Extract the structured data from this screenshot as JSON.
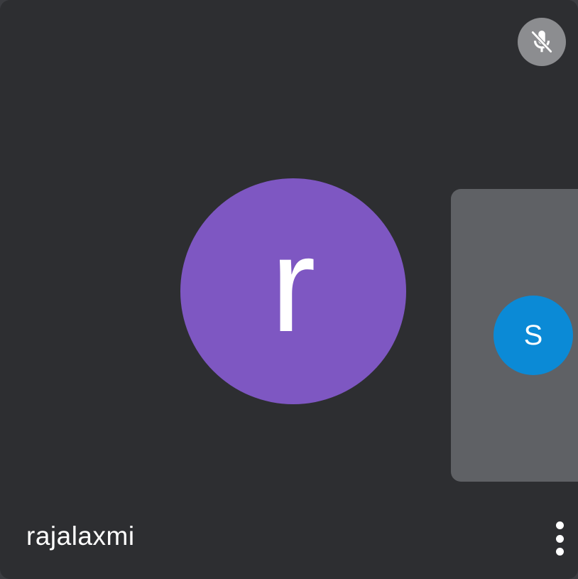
{
  "participant": {
    "name": "rajalaxmi",
    "initial": "r",
    "avatar_color": "#7e57c2",
    "muted": true,
    "mute_icon": "mic-off-icon"
  },
  "self_view": {
    "initial": "S",
    "avatar_color": "#0b8ad6"
  },
  "controls": {
    "more_icon": "more-vert-icon"
  },
  "colors": {
    "tile_background": "#2d2e31",
    "pip_background": "#5f6165",
    "mute_badge": "#8c8d90"
  }
}
